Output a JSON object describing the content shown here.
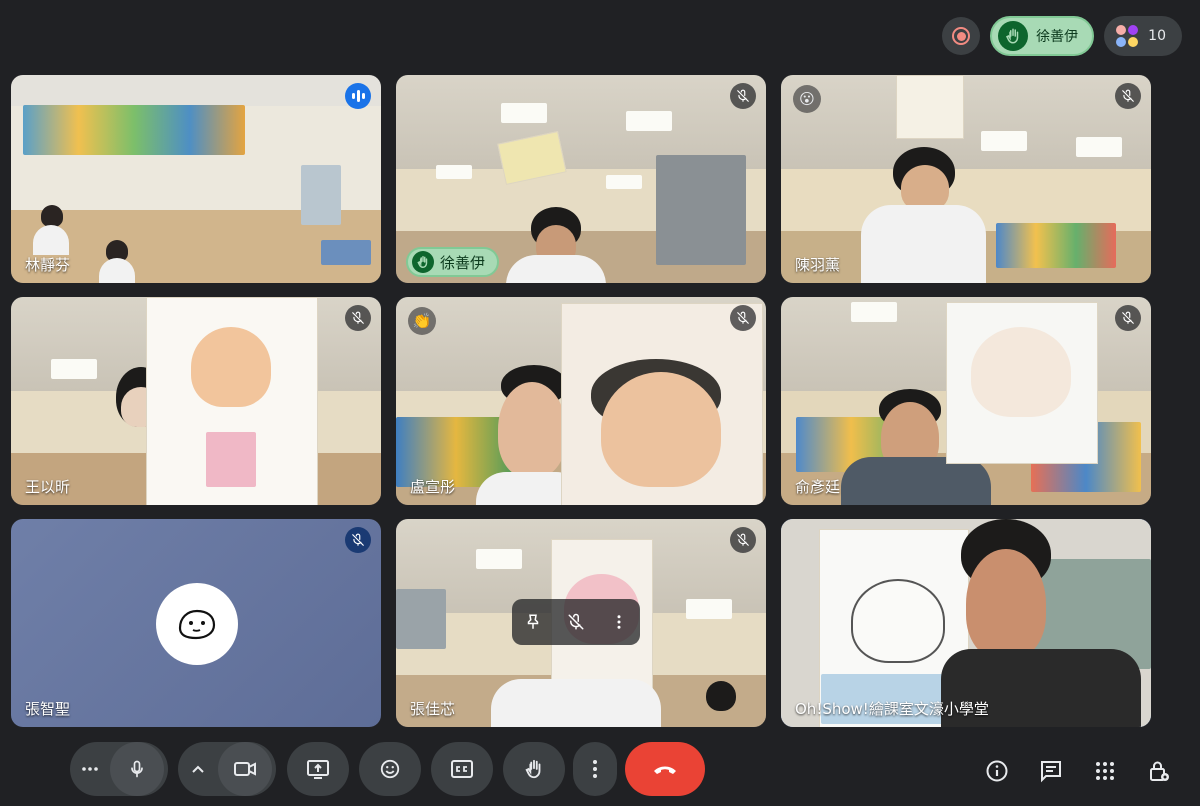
{
  "topbar": {
    "record_icon": "record-icon",
    "raised_hand_name": "徐善伊",
    "participant_count": "10"
  },
  "tiles": [
    {
      "name": "林靜芬",
      "status": "speaking"
    },
    {
      "name": "",
      "status": "muted",
      "raised_hand": "徐善伊"
    },
    {
      "name": "陳羽薰",
      "status": "muted",
      "reaction": "😮"
    },
    {
      "name": "王以昕",
      "status": "muted"
    },
    {
      "name": "盧宣彤",
      "status": "muted",
      "reaction": "👏"
    },
    {
      "name": "俞彥廷",
      "status": "muted"
    },
    {
      "name": "張智聖",
      "status": "muted",
      "camera": "off"
    },
    {
      "name": "張佳芯",
      "status": "muted"
    },
    {
      "name": "Oh!Show!繪課室文濠小學堂",
      "status": "self"
    }
  ],
  "colors": {
    "background": "#202124",
    "control": "#3c4043",
    "end_call": "#ea4335",
    "hand_green": "#a8dab5",
    "speaking_blue": "#1a73e8"
  },
  "controls": {
    "left": [
      "more-options-icon",
      "microphone-icon",
      "chevron-up-icon",
      "camera-icon",
      "present-screen-icon",
      "emoji-icon",
      "captions-icon",
      "raise-hand-icon",
      "more-vert-icon",
      "end-call-icon"
    ],
    "right": [
      "info-icon",
      "chat-icon",
      "activities-icon",
      "host-controls-icon"
    ]
  }
}
